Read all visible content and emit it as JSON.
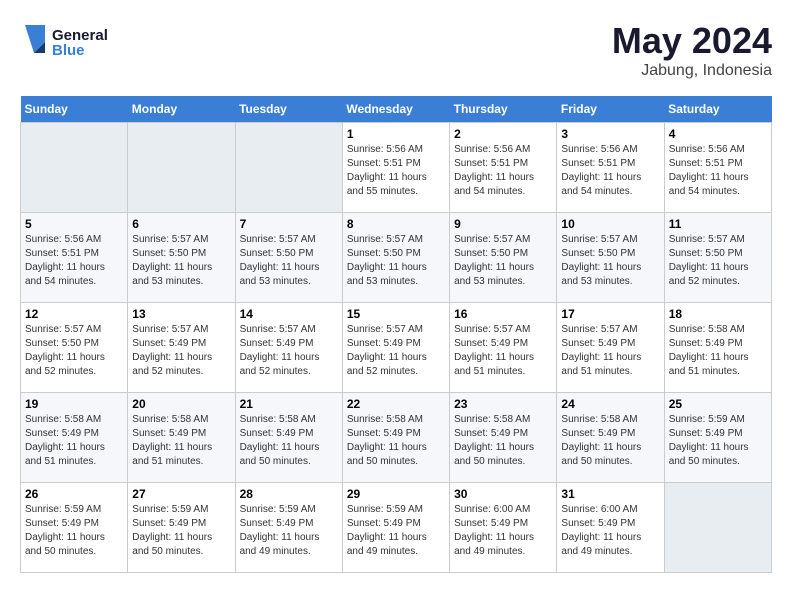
{
  "logo": {
    "line1": "General",
    "line2": "Blue"
  },
  "title": "May 2024",
  "subtitle": "Jabung, Indonesia",
  "days_of_week": [
    "Sunday",
    "Monday",
    "Tuesday",
    "Wednesday",
    "Thursday",
    "Friday",
    "Saturday"
  ],
  "weeks": [
    [
      {
        "day": "",
        "info": ""
      },
      {
        "day": "",
        "info": ""
      },
      {
        "day": "",
        "info": ""
      },
      {
        "day": "1",
        "info": "Sunrise: 5:56 AM\nSunset: 5:51 PM\nDaylight: 11 hours\nand 55 minutes."
      },
      {
        "day": "2",
        "info": "Sunrise: 5:56 AM\nSunset: 5:51 PM\nDaylight: 11 hours\nand 54 minutes."
      },
      {
        "day": "3",
        "info": "Sunrise: 5:56 AM\nSunset: 5:51 PM\nDaylight: 11 hours\nand 54 minutes."
      },
      {
        "day": "4",
        "info": "Sunrise: 5:56 AM\nSunset: 5:51 PM\nDaylight: 11 hours\nand 54 minutes."
      }
    ],
    [
      {
        "day": "5",
        "info": "Sunrise: 5:56 AM\nSunset: 5:51 PM\nDaylight: 11 hours\nand 54 minutes."
      },
      {
        "day": "6",
        "info": "Sunrise: 5:57 AM\nSunset: 5:50 PM\nDaylight: 11 hours\nand 53 minutes."
      },
      {
        "day": "7",
        "info": "Sunrise: 5:57 AM\nSunset: 5:50 PM\nDaylight: 11 hours\nand 53 minutes."
      },
      {
        "day": "8",
        "info": "Sunrise: 5:57 AM\nSunset: 5:50 PM\nDaylight: 11 hours\nand 53 minutes."
      },
      {
        "day": "9",
        "info": "Sunrise: 5:57 AM\nSunset: 5:50 PM\nDaylight: 11 hours\nand 53 minutes."
      },
      {
        "day": "10",
        "info": "Sunrise: 5:57 AM\nSunset: 5:50 PM\nDaylight: 11 hours\nand 53 minutes."
      },
      {
        "day": "11",
        "info": "Sunrise: 5:57 AM\nSunset: 5:50 PM\nDaylight: 11 hours\nand 52 minutes."
      }
    ],
    [
      {
        "day": "12",
        "info": "Sunrise: 5:57 AM\nSunset: 5:50 PM\nDaylight: 11 hours\nand 52 minutes."
      },
      {
        "day": "13",
        "info": "Sunrise: 5:57 AM\nSunset: 5:49 PM\nDaylight: 11 hours\nand 52 minutes."
      },
      {
        "day": "14",
        "info": "Sunrise: 5:57 AM\nSunset: 5:49 PM\nDaylight: 11 hours\nand 52 minutes."
      },
      {
        "day": "15",
        "info": "Sunrise: 5:57 AM\nSunset: 5:49 PM\nDaylight: 11 hours\nand 52 minutes."
      },
      {
        "day": "16",
        "info": "Sunrise: 5:57 AM\nSunset: 5:49 PM\nDaylight: 11 hours\nand 51 minutes."
      },
      {
        "day": "17",
        "info": "Sunrise: 5:57 AM\nSunset: 5:49 PM\nDaylight: 11 hours\nand 51 minutes."
      },
      {
        "day": "18",
        "info": "Sunrise: 5:58 AM\nSunset: 5:49 PM\nDaylight: 11 hours\nand 51 minutes."
      }
    ],
    [
      {
        "day": "19",
        "info": "Sunrise: 5:58 AM\nSunset: 5:49 PM\nDaylight: 11 hours\nand 51 minutes."
      },
      {
        "day": "20",
        "info": "Sunrise: 5:58 AM\nSunset: 5:49 PM\nDaylight: 11 hours\nand 51 minutes."
      },
      {
        "day": "21",
        "info": "Sunrise: 5:58 AM\nSunset: 5:49 PM\nDaylight: 11 hours\nand 50 minutes."
      },
      {
        "day": "22",
        "info": "Sunrise: 5:58 AM\nSunset: 5:49 PM\nDaylight: 11 hours\nand 50 minutes."
      },
      {
        "day": "23",
        "info": "Sunrise: 5:58 AM\nSunset: 5:49 PM\nDaylight: 11 hours\nand 50 minutes."
      },
      {
        "day": "24",
        "info": "Sunrise: 5:58 AM\nSunset: 5:49 PM\nDaylight: 11 hours\nand 50 minutes."
      },
      {
        "day": "25",
        "info": "Sunrise: 5:59 AM\nSunset: 5:49 PM\nDaylight: 11 hours\nand 50 minutes."
      }
    ],
    [
      {
        "day": "26",
        "info": "Sunrise: 5:59 AM\nSunset: 5:49 PM\nDaylight: 11 hours\nand 50 minutes."
      },
      {
        "day": "27",
        "info": "Sunrise: 5:59 AM\nSunset: 5:49 PM\nDaylight: 11 hours\nand 50 minutes."
      },
      {
        "day": "28",
        "info": "Sunrise: 5:59 AM\nSunset: 5:49 PM\nDaylight: 11 hours\nand 49 minutes."
      },
      {
        "day": "29",
        "info": "Sunrise: 5:59 AM\nSunset: 5:49 PM\nDaylight: 11 hours\nand 49 minutes."
      },
      {
        "day": "30",
        "info": "Sunrise: 6:00 AM\nSunset: 5:49 PM\nDaylight: 11 hours\nand 49 minutes."
      },
      {
        "day": "31",
        "info": "Sunrise: 6:00 AM\nSunset: 5:49 PM\nDaylight: 11 hours\nand 49 minutes."
      },
      {
        "day": "",
        "info": ""
      }
    ]
  ]
}
